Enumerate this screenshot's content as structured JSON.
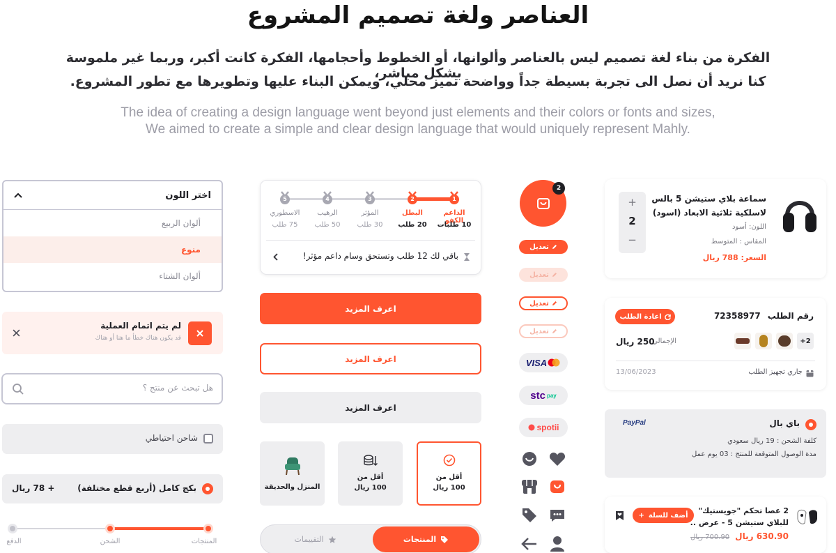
{
  "hero": {
    "title": "العناصر ولغة تصميم المشروع",
    "ar_line1": "الفكرة من بناء لغة تصميم ليس بالعناصر وألوانها، أو الخطوط وأحجامها، الفكرة كانت أكبر، وربما غير ملموسة بشكل مباشر،",
    "ar_line2": "كنا نريد أن نصل الى تجربة بسيطة جداً وواضحة تميز محلي، ويمكن البناء عليها وتطويرها مع تطور المشروع.",
    "en_line1": "The idea of creating a design language went beyond just elements and their colors or fonts and sizes,",
    "en_line2": "We aimed to create a simple and clear design language that would uniquely represent Mahly."
  },
  "colors": {
    "accent": "#ff5530",
    "grey_bg": "#eeeef0",
    "text": "#1f1f24",
    "muted": "#8c8c96"
  },
  "dropdown": {
    "title": "اختر اللون",
    "options": [
      {
        "label": "ألوان الربيع",
        "selected": false
      },
      {
        "label": "منوع",
        "selected": true
      },
      {
        "label": "ألوان الشتاء",
        "selected": false
      }
    ]
  },
  "error": {
    "title": "لم يتم اتمام العملية",
    "subtitle": "قد يكون هناك خطأ ما هنا أو هناك"
  },
  "search": {
    "placeholder": "هل تبحث عن منتج ؟"
  },
  "checkbox": {
    "label": "شاحن احتياطي",
    "checked": false
  },
  "package": {
    "label": "بكج كامل (أربع قطع مختلفة)",
    "price": "+ 78 ريال"
  },
  "steps": {
    "items": [
      "المنتجات",
      "الشحن",
      "الدفع"
    ],
    "active_index": 1
  },
  "tiers": {
    "items": [
      {
        "name": "الداعم الكفو",
        "count": "10 طلبات",
        "num": "1",
        "active": true
      },
      {
        "name": "البطل",
        "count": "20 طلب",
        "num": "2",
        "active": true
      },
      {
        "name": "المؤثر",
        "count": "30 طلب",
        "num": "3",
        "active": false
      },
      {
        "name": "الرهيب",
        "count": "50 طلب",
        "num": "4",
        "active": false
      },
      {
        "name": "الاسطوري",
        "count": "75 طلب",
        "num": "5",
        "active": false
      }
    ],
    "message": "باقي لك 12 طلب وتستحق وسام داعم مؤثر!"
  },
  "buttons": {
    "primary": "اعرف المزيد",
    "outline": "اعرف المزيد",
    "secondary": "اعرف المزيد"
  },
  "tiles": [
    {
      "line1": "أقل من",
      "line2": "100 ريال",
      "icon": "check-circle-icon",
      "selected": true
    },
    {
      "line1": "أقل من",
      "line2": "100 ريال",
      "icon": "coins-down-icon",
      "selected": false
    },
    {
      "line1": "المنزل والحديقة",
      "line2": "",
      "icon": "armchair-icon",
      "selected": false
    }
  ],
  "tabs": {
    "products": "المنتجات",
    "reviews": "التقييمات"
  },
  "cart_badge": "2",
  "edit_pills": [
    "تعديل",
    "تعديل",
    "تعديل",
    "تعديل"
  ],
  "payments": {
    "visa": "VISA",
    "stc": "stc",
    "stc_pay": "pay",
    "spotii": "spotii"
  },
  "product": {
    "name_line1": "سماعة بلاي ستيشن 5 بالس",
    "name_line2": "لاسلكية ثلاثية الابعاد (اسود)",
    "color": "اللون: أسود",
    "size": "المقاس : المتوسط",
    "price": "السعر: 788 ريال",
    "qty": "2",
    "plus": "+",
    "minus": "−"
  },
  "order": {
    "number_label": "رقم الطلب",
    "number": "72358977",
    "reorder": "اعادة الطلب",
    "total_label": "الإجمالي",
    "total": "250 ريال",
    "more_items": "+2",
    "status": "جاري تجهيز الطلب",
    "date": "13/06/2023"
  },
  "paypal": {
    "title": "باي بال",
    "brand": "PayPal",
    "shipping": "كلفة الشحن : 19 ريال سعودي",
    "delivery": "مدة الوصول المتوقعة للمنتج : 03 يوم عمل"
  },
  "deal": {
    "title_line1": "2 عصا تحكم \"جويستيك\"",
    "title_line2": "للبلاي ستيشن 5 - عرض ..",
    "price": "630.90 ريال",
    "old_price": "700.90 ريال",
    "add": "أضف للسلة"
  }
}
